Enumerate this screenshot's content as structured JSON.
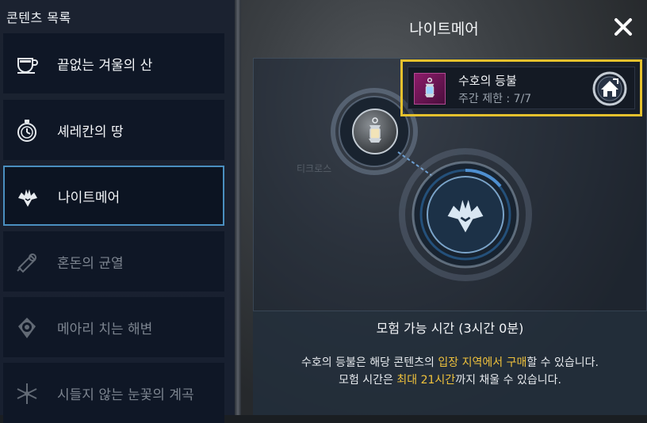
{
  "sidebar": {
    "title": "콘텐츠 목록",
    "items": [
      {
        "label": "끝없는 겨울의 산",
        "icon": "teacup-icon",
        "state": "normal"
      },
      {
        "label": "셰레칸의 땅",
        "icon": "stopwatch-icon",
        "state": "normal"
      },
      {
        "label": "나이트메어",
        "icon": "nightmare-icon",
        "state": "selected"
      },
      {
        "label": "혼돈의 균열",
        "icon": "scroll-icon",
        "state": "disabled"
      },
      {
        "label": "메아리 치는 해변",
        "icon": "compass-icon",
        "state": "disabled"
      },
      {
        "label": "시들지 않는 눈꽃의 계곡",
        "icon": "snowflake-icon",
        "state": "disabled"
      }
    ]
  },
  "dialog": {
    "title": "나이트메어",
    "close_icon": "close-icon",
    "background_label": "티크로스"
  },
  "reward": {
    "name": "수호의 등불",
    "limit": "주간 제한 : 7/7",
    "thumb_icon": "lantern-icon",
    "action_icon": "home-arrow-icon"
  },
  "info": {
    "title": "모험 가능 시간 (3시간 0분)",
    "line1": {
      "before": "수호의 등불은 해당 콘텐츠의 ",
      "highlight1": "입장 지역에서",
      "between": " ",
      "highlight2": "구매",
      "after": "할 수 있습니다."
    },
    "line2": {
      "before": "모험 시간은 ",
      "highlight": "최대 21시간",
      "after": "까지 채울 수 있습니다."
    }
  },
  "colors": {
    "highlight": "#f0c23c",
    "selected_border": "#4a8fc0",
    "reward_border": "#e5c12d"
  }
}
